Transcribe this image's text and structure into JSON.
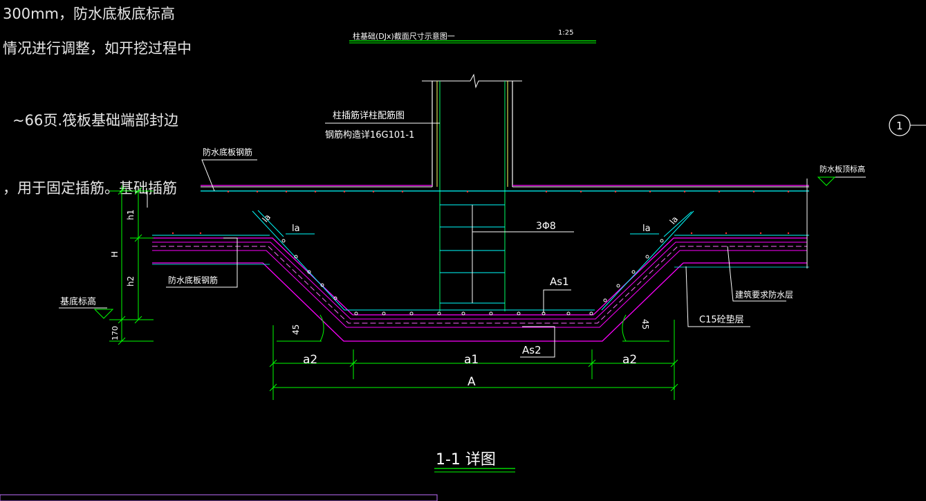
{
  "notes": [
    "300mm，防水底板底标高",
    "情况进行调整，如开挖过程中",
    "~66页.筏板基础端部封边",
    "，用于固定插筋。基础插筋"
  ],
  "drawing": {
    "header_title": "柱基础(DJx)截面尺寸示意图一",
    "header_scale": "1:25",
    "footer_title": "1-1  详图",
    "axis_bubble": "1"
  },
  "labels": {
    "column_note_1": "柱插筋详柱配筋图",
    "column_note_2": "钢筋构造详16G101-1",
    "raft_rebar_top": "防水底板钢筋",
    "raft_rebar_left": "防水底板钢筋",
    "raft_top_elev": "防水板顶标高",
    "base_elev": "基底标高",
    "stirrup": "3Φ8",
    "as1": "As1",
    "as2": "As2",
    "la_left_diag": "la",
    "la_left": "la",
    "la_right": "la",
    "la_right_diag": "la",
    "waterproof": "建筑要求防水层",
    "cushion": "C15砼垫层",
    "angle_left": "45",
    "angle_right": "45"
  },
  "dimensions": {
    "a2_left": "a2",
    "a1": "a1",
    "a2_right": "a2",
    "A": "A",
    "h1": "h1",
    "h2": "h2",
    "H": "H",
    "t170": "170"
  },
  "colors": {
    "background": "#000000",
    "dimension": "#00ff00",
    "rebar": "#ff00ff",
    "axis": "#00ffff",
    "column": "#ffff66",
    "text": "#ffffff"
  }
}
